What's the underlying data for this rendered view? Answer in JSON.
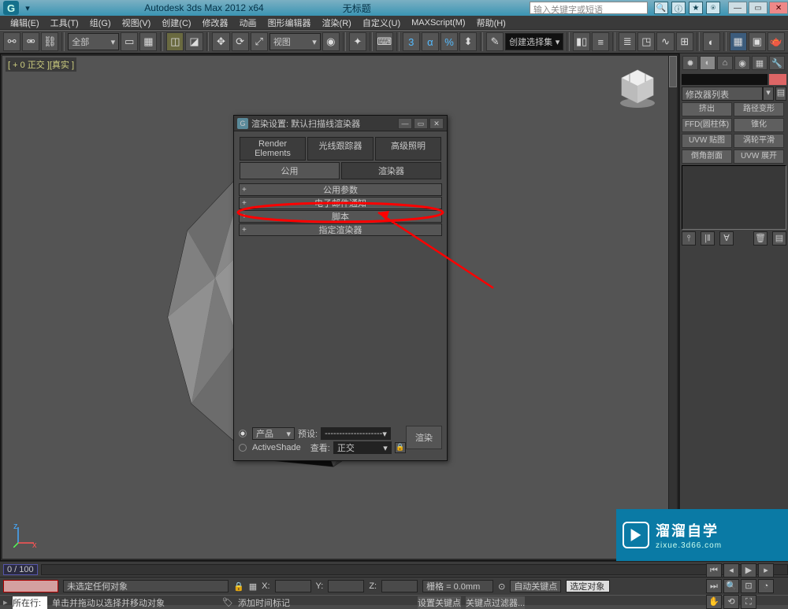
{
  "titlebar": {
    "app": "Autodesk 3ds Max  2012  x64",
    "untitled": "无标题",
    "search_ph": "输入关键字或短语"
  },
  "menu": [
    "编辑(E)",
    "工具(T)",
    "组(G)",
    "视图(V)",
    "创建(C)",
    "修改器",
    "动画",
    "图形编辑器",
    "渲染(R)",
    "自定义(U)",
    "MAXScript(M)",
    "帮助(H)"
  ],
  "toolbar": {
    "sel_scope": "全部",
    "view": "视图",
    "selection_set": "创建选择集"
  },
  "viewport": {
    "label": "[ + 0 正交 ][真实 ]"
  },
  "right": {
    "modifier_list": "修改器列表",
    "buttons": [
      "挤出",
      "路径变形",
      "FFD(圆柱体)",
      "锥化",
      "UVW 贴图",
      "涡轮平滑",
      "倒角剖面",
      "UVW 展开"
    ]
  },
  "dialog": {
    "title": "渲染设置: 默认扫描线渲染器",
    "tabs_top": [
      "Render Elements",
      "光线跟踪器",
      "高级照明"
    ],
    "tabs_bot": [
      "公用",
      "渲染器"
    ],
    "rollouts": [
      "公用参数",
      "电子邮件通知",
      "脚本",
      "指定渲染器"
    ],
    "product": "产品",
    "preset_lbl": "预设:",
    "preset_val": "--------------------",
    "activeshade": "ActiveShade",
    "view_lbl": "查看:",
    "view_val": "正交",
    "render": "渲染"
  },
  "status": {
    "none_selected": "未选定任何对象",
    "xl": "X:",
    "yl": "Y:",
    "zl": "Z:",
    "grid": "栅格 = 0.0mm",
    "autokey": "自动关键点",
    "selected": "选定对象",
    "hint": "单击并拖动以选择并移动对象",
    "addtag": "添加时间标记",
    "setkey": "设置关键点",
    "keyfilter": "关键点过滤器...",
    "row_lbl": "所在行:"
  },
  "timeline": {
    "range": "0 / 100"
  },
  "watermark": {
    "name": "溜溜自学",
    "url": "zixue.3d66.com"
  }
}
